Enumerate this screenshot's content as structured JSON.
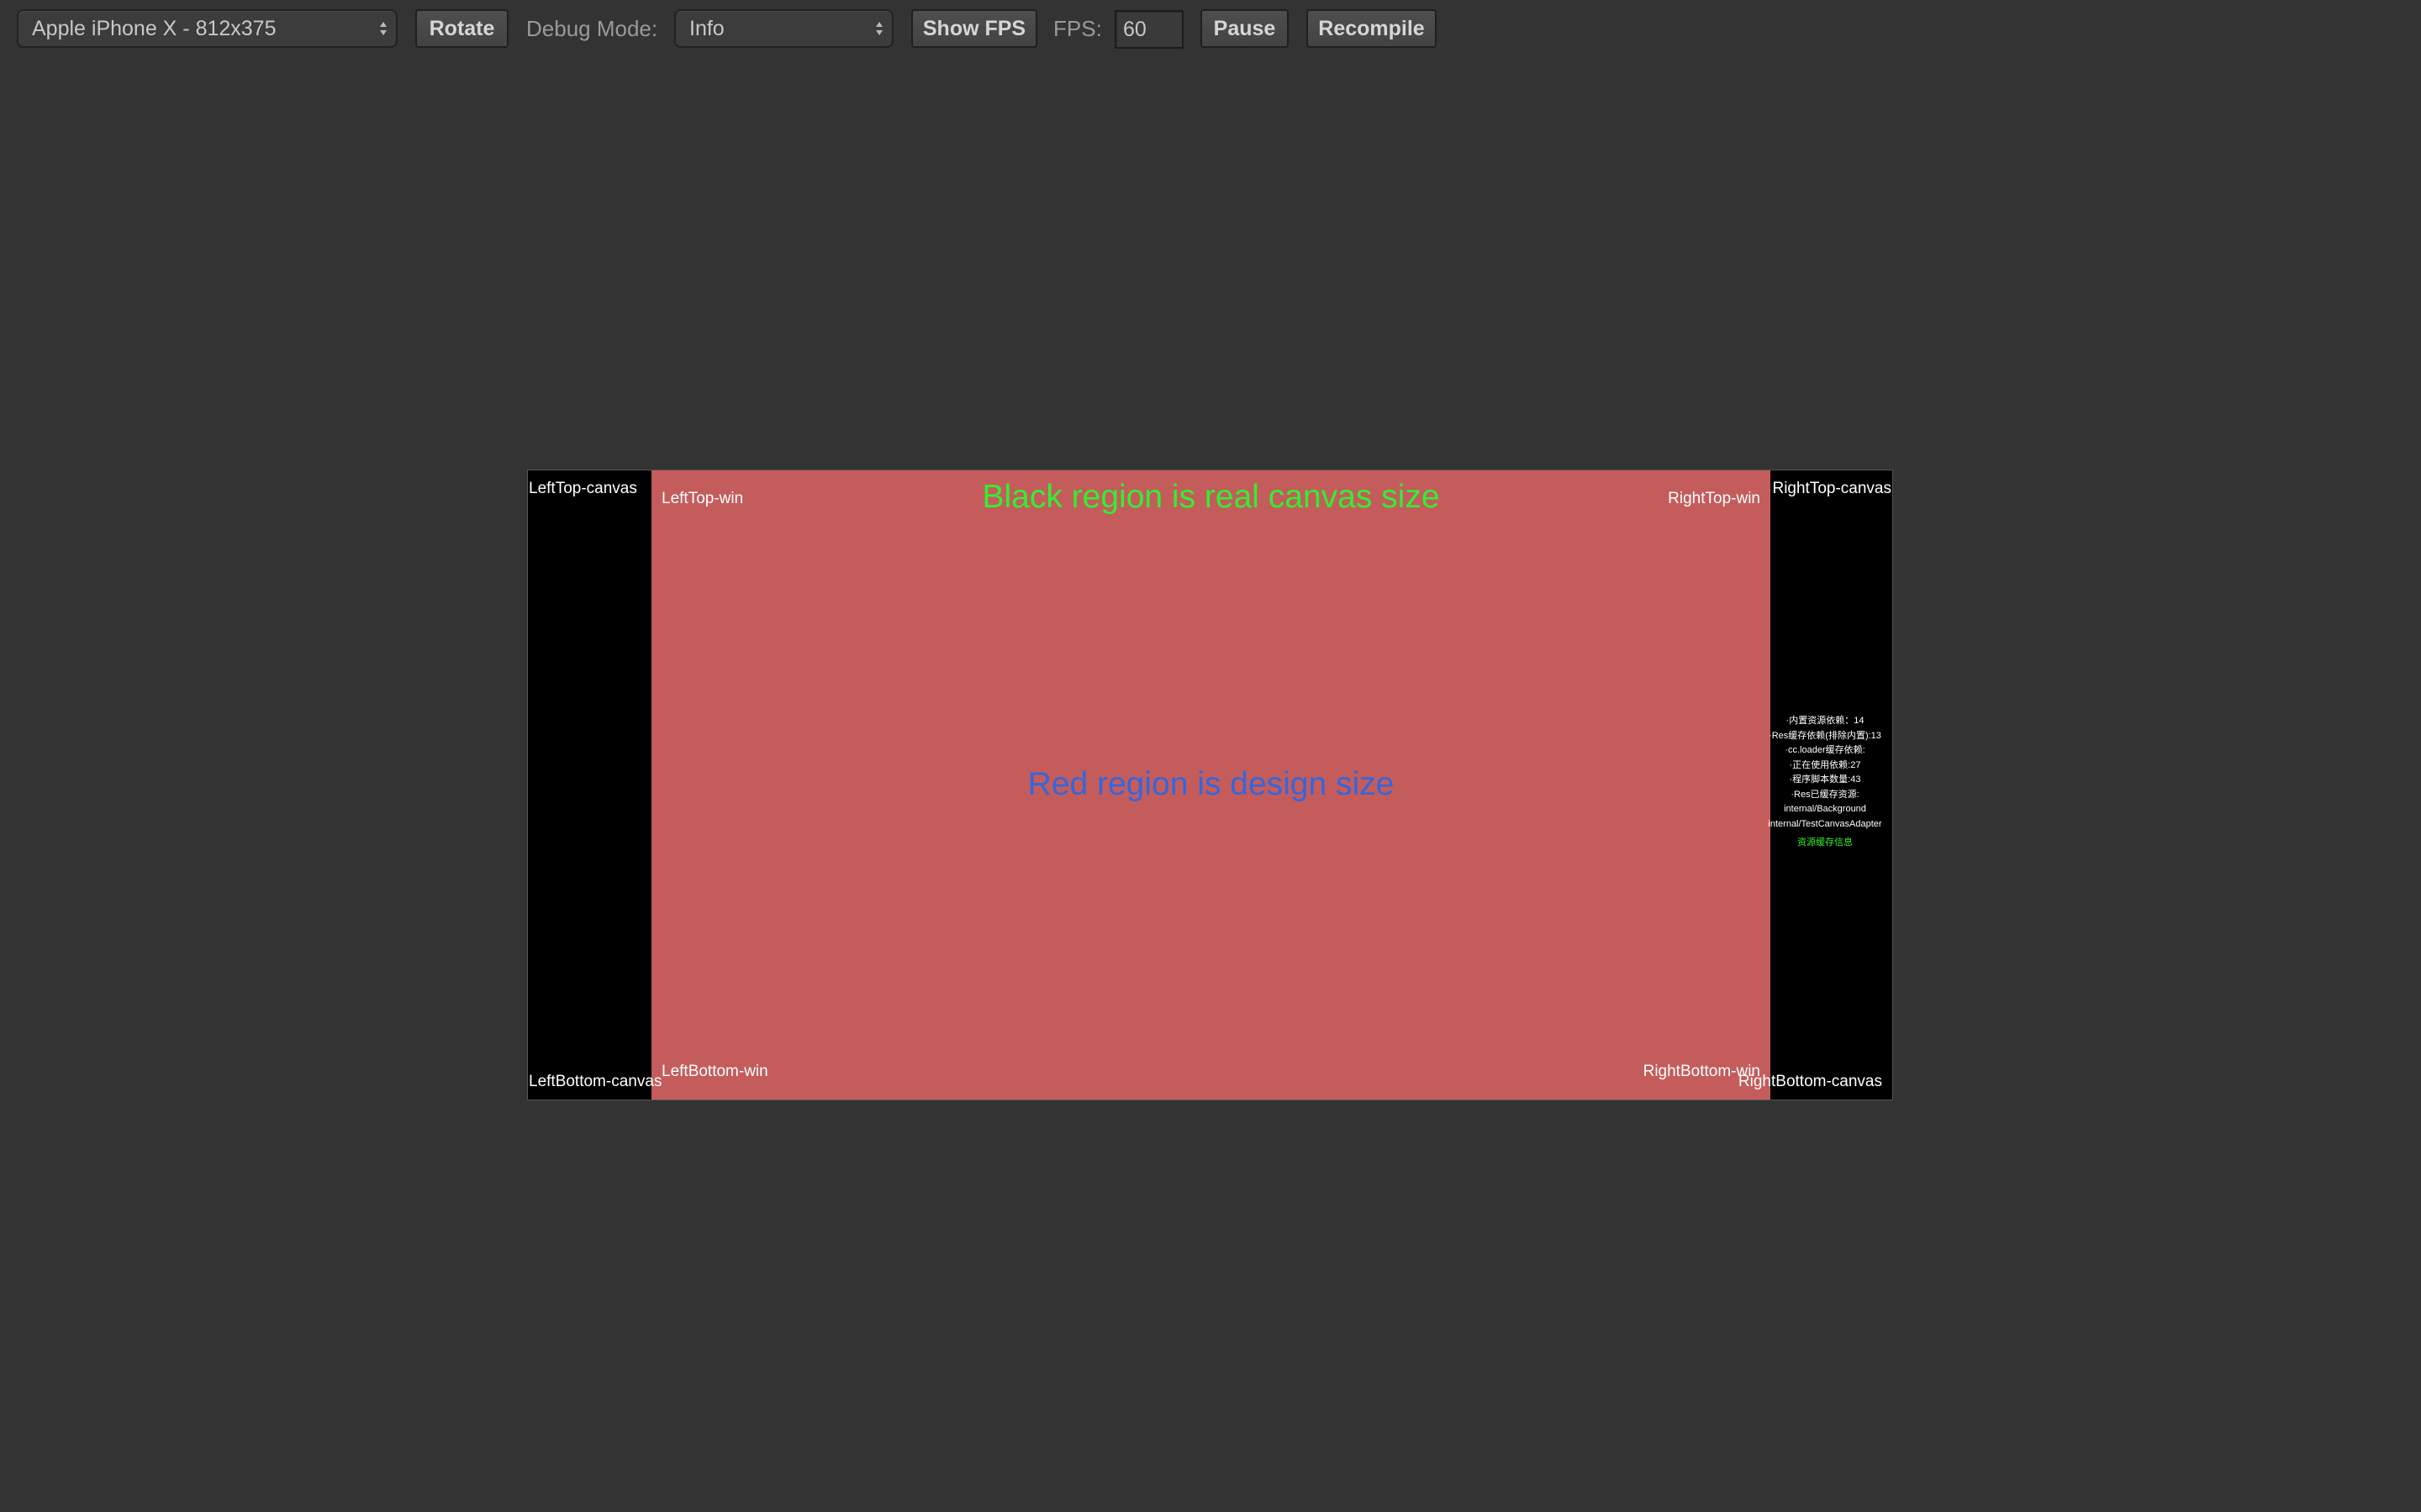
{
  "toolbar": {
    "device_select_value": "Apple iPhone X - 812x375",
    "rotate_label": "Rotate",
    "debug_mode_label": "Debug Mode:",
    "debug_mode_value": "Info",
    "show_fps_label": "Show FPS",
    "fps_label": "FPS:",
    "fps_value": "60",
    "pause_label": "Pause",
    "recompile_label": "Recompile"
  },
  "scene": {
    "canvas_color": "#000000",
    "design_color": "#c45c5c",
    "title_real": "Black region is real canvas size",
    "title_design": "Red region is design size",
    "canvas_labels": {
      "left_top": "LeftTop-canvas",
      "right_top": "RightTop-canvas",
      "left_bottom": "LeftBottom-canvas",
      "right_bottom": "RightBottom-canvas"
    },
    "win_labels": {
      "left_top": "LeftTop-win",
      "right_top": "RightTop-win",
      "left_bottom": "LeftBottom-win",
      "right_bottom": "RightBottom-win"
    },
    "debug_info": [
      "·内置资源依赖：14",
      "·Res缓存依赖(排除内置):13",
      "·cc.loader缓存依赖:",
      "·正在使用依赖:27",
      "·程序脚本数量:43",
      "·Res已缓存资源:",
      "internal/Background",
      "internal/TestCanvasAdapter"
    ],
    "debug_button": "资源缓存信息"
  }
}
